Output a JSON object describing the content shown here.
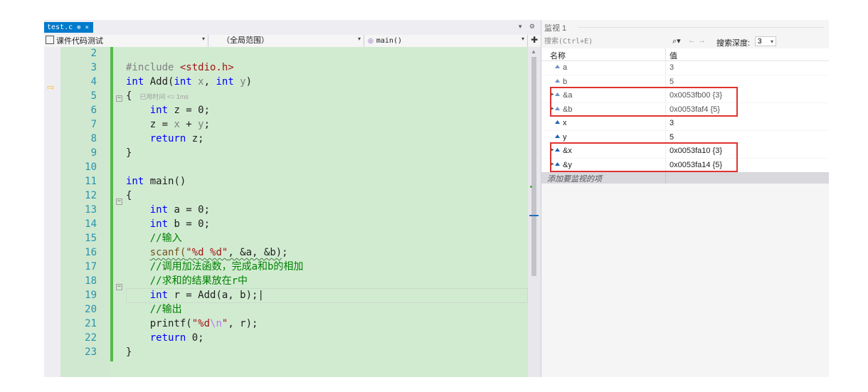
{
  "tab": {
    "title": "test.c",
    "pin_glyph": "⊕",
    "close_glyph": "×"
  },
  "navbar": {
    "project": "课件代码测试",
    "scope": "（全局范围）",
    "member": "main()"
  },
  "code_lines": [
    {
      "num": "2",
      "tokens": []
    },
    {
      "num": "3",
      "tokens": [
        {
          "t": "#include ",
          "c": "param"
        },
        {
          "t": "<stdio.h>",
          "c": "str"
        }
      ]
    },
    {
      "num": "4",
      "tokens": [
        {
          "t": "int",
          "c": "kw"
        },
        {
          "t": " Add(",
          "c": ""
        },
        {
          "t": "int",
          "c": "kw"
        },
        {
          "t": " x",
          "c": "param"
        },
        {
          "t": ", ",
          "c": ""
        },
        {
          "t": "int",
          "c": "kw"
        },
        {
          "t": " y",
          "c": "param"
        },
        {
          "t": ")",
          "c": ""
        }
      ]
    },
    {
      "num": "5",
      "tokens": [
        {
          "t": "{ ",
          "c": ""
        },
        {
          "t": " 已用时间 <= 1ms",
          "c": "codelens"
        }
      ]
    },
    {
      "num": "6",
      "tokens": [
        {
          "t": "    ",
          "c": ""
        },
        {
          "t": "int",
          "c": "kw"
        },
        {
          "t": " z = 0;",
          "c": ""
        }
      ]
    },
    {
      "num": "7",
      "tokens": [
        {
          "t": "    z = ",
          "c": ""
        },
        {
          "t": "x",
          "c": "param"
        },
        {
          "t": " + ",
          "c": ""
        },
        {
          "t": "y",
          "c": "param"
        },
        {
          "t": ";",
          "c": ""
        }
      ]
    },
    {
      "num": "8",
      "tokens": [
        {
          "t": "    ",
          "c": ""
        },
        {
          "t": "return",
          "c": "kw"
        },
        {
          "t": " z;",
          "c": ""
        }
      ]
    },
    {
      "num": "9",
      "tokens": [
        {
          "t": "}",
          "c": ""
        }
      ]
    },
    {
      "num": "10",
      "tokens": []
    },
    {
      "num": "11",
      "tokens": [
        {
          "t": "int",
          "c": "kw"
        },
        {
          "t": " main()",
          "c": ""
        }
      ]
    },
    {
      "num": "12",
      "tokens": [
        {
          "t": "{",
          "c": ""
        }
      ]
    },
    {
      "num": "13",
      "tokens": [
        {
          "t": "    ",
          "c": ""
        },
        {
          "t": "int",
          "c": "kw"
        },
        {
          "t": " a = 0;",
          "c": ""
        }
      ]
    },
    {
      "num": "14",
      "tokens": [
        {
          "t": "    ",
          "c": ""
        },
        {
          "t": "int",
          "c": "kw"
        },
        {
          "t": " b = 0;",
          "c": ""
        }
      ]
    },
    {
      "num": "15",
      "tokens": [
        {
          "t": "    ",
          "c": ""
        },
        {
          "t": "//输入",
          "c": "cm"
        }
      ]
    },
    {
      "num": "16",
      "tokens": [
        {
          "t": "    ",
          "c": ""
        },
        {
          "t": "scanf(",
          "c": "squig fn"
        },
        {
          "t": "\"%d %d\"",
          "c": "squig str"
        },
        {
          "t": ", &a, &b)",
          "c": "squig"
        },
        {
          "t": ";",
          "c": ""
        }
      ]
    },
    {
      "num": "17",
      "tokens": [
        {
          "t": "    ",
          "c": ""
        },
        {
          "t": "//调用加法函数，完成a和b的相加",
          "c": "cm"
        }
      ]
    },
    {
      "num": "18",
      "tokens": [
        {
          "t": "    ",
          "c": ""
        },
        {
          "t": "//求和的结果放在r中",
          "c": "cm"
        }
      ]
    },
    {
      "num": "19",
      "tokens": [
        {
          "t": "    ",
          "c": ""
        },
        {
          "t": "int",
          "c": "kw"
        },
        {
          "t": " r = Add(a, b);|",
          "c": ""
        }
      ]
    },
    {
      "num": "20",
      "tokens": [
        {
          "t": "    ",
          "c": ""
        },
        {
          "t": "//输出",
          "c": "cm"
        }
      ]
    },
    {
      "num": "21",
      "tokens": [
        {
          "t": "    printf(",
          "c": ""
        },
        {
          "t": "\"%d",
          "c": "str"
        },
        {
          "t": "\\n",
          "c": "esc"
        },
        {
          "t": "\"",
          "c": "str"
        },
        {
          "t": ", r);",
          "c": ""
        }
      ]
    },
    {
      "num": "22",
      "tokens": [
        {
          "t": "    ",
          "c": ""
        },
        {
          "t": "return",
          "c": "kw"
        },
        {
          "t": " 0;",
          "c": ""
        }
      ]
    },
    {
      "num": "23",
      "tokens": [
        {
          "t": "}",
          "c": ""
        }
      ]
    }
  ],
  "watch": {
    "title": "监视 1",
    "search_placeholder": "搜索(Ctrl+E)",
    "search_depth_label": "搜索深度:",
    "search_depth_value": "3",
    "col_name": "名称",
    "col_value": "值",
    "rows": [
      {
        "name": "a",
        "value": "3",
        "expandable": false,
        "dim": true
      },
      {
        "name": "b",
        "value": "5",
        "expandable": false,
        "dim": true
      },
      {
        "name": "&a",
        "value": "0x0053fb00 {3}",
        "expandable": true,
        "dim": true
      },
      {
        "name": "&b",
        "value": "0x0053faf4 {5}",
        "expandable": true,
        "dim": true
      },
      {
        "name": "x",
        "value": "3",
        "expandable": false,
        "dim": false
      },
      {
        "name": "y",
        "value": "5",
        "expandable": false,
        "dim": false
      },
      {
        "name": "&x",
        "value": "0x0053fa10 {3}",
        "expandable": true,
        "dim": false
      },
      {
        "name": "&y",
        "value": "0x0053fa14 {5}",
        "expandable": true,
        "dim": false
      }
    ],
    "add_item_label": "添加要监视的项"
  },
  "colors": {
    "accent_tab": "#007acc",
    "keyword": "#0000ff",
    "string": "#a31515",
    "comment": "#008000",
    "line_number": "#2b91af",
    "changed_background": "#d1ebd1",
    "highlight_box": "#e0332f"
  }
}
